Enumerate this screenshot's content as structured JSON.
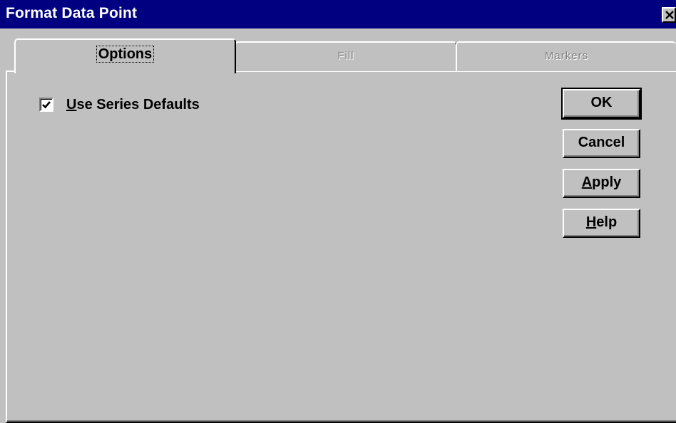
{
  "window": {
    "title": "Format Data Point",
    "close_glyph": "✕"
  },
  "tabs": [
    {
      "label": "Options",
      "state": "active"
    },
    {
      "label": "Fill",
      "state": "disabled"
    },
    {
      "label": "Markers",
      "state": "disabled"
    }
  ],
  "options": {
    "use_series_defaults": {
      "label_mnemonic": "U",
      "label_rest": "se Series Defaults",
      "checked": true
    }
  },
  "buttons": {
    "ok": {
      "label": "OK"
    },
    "cancel": {
      "label": "Cancel"
    },
    "apply": {
      "mnemonic": "A",
      "rest": "pply"
    },
    "help": {
      "mnemonic": "H",
      "rest": "elp"
    }
  },
  "icons": {
    "close": "close-icon",
    "check": "checkmark-icon"
  },
  "colors": {
    "titlebar": "#000080",
    "face": "#c0c0c0",
    "shadow": "#808080",
    "highlight": "#ffffff"
  }
}
